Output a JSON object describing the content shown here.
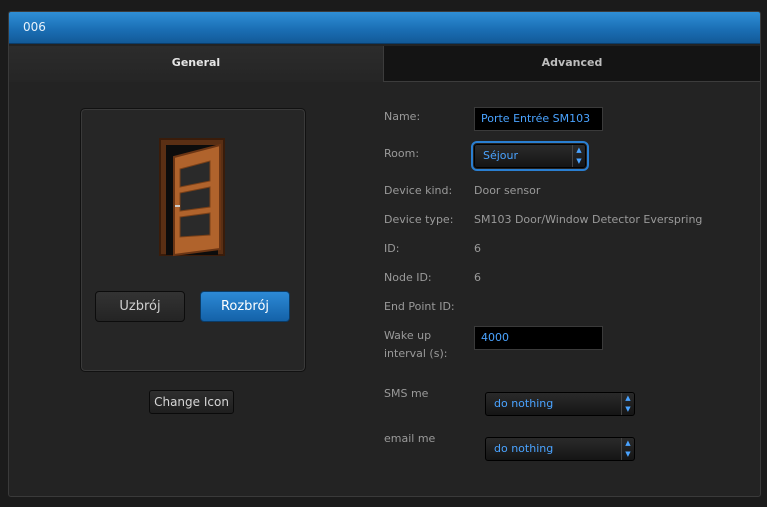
{
  "window": {
    "title": "006"
  },
  "tabs": [
    {
      "label": "General",
      "active": true
    },
    {
      "label": "Advanced",
      "active": false
    }
  ],
  "icon_panel": {
    "icon": "door-open-icon",
    "arm_button": "Uzbrój",
    "disarm_button": "Rozbrój",
    "change_icon_button": "Change Icon"
  },
  "fields": {
    "name": {
      "label": "Name:",
      "value": "Porte Entrée SM103"
    },
    "room": {
      "label": "Room:",
      "value": "Séjour"
    },
    "device_kind": {
      "label": "Device kind:",
      "value": "Door sensor"
    },
    "device_type": {
      "label": "Device type:",
      "value": "SM103 Door/Window Detector Everspring"
    },
    "id": {
      "label": "ID:",
      "value": "6"
    },
    "node_id": {
      "label": "Node ID:",
      "value": "6"
    },
    "end_point_id": {
      "label": "End Point ID:",
      "value": ""
    },
    "wake_up": {
      "label_line1": "Wake up",
      "label_line2": "interval (s):",
      "value": "4000"
    },
    "sms_me": {
      "label": "SMS me",
      "value": "do nothing"
    },
    "email_me": {
      "label": "email me",
      "value": "do nothing"
    }
  },
  "colors": {
    "accent": "#1b6fb5",
    "input_text": "#4aa3ff"
  }
}
